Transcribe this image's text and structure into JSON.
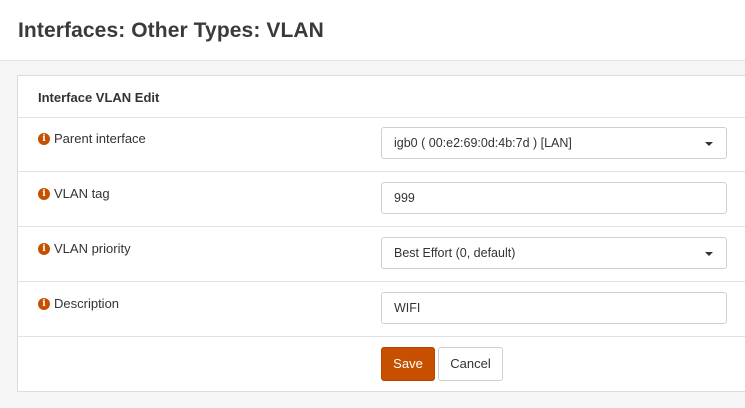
{
  "page": {
    "title": "Interfaces: Other Types: VLAN"
  },
  "panel": {
    "heading": "Interface VLAN Edit",
    "fields": [
      {
        "label": "Parent interface",
        "value": "igb0 ( 00:e2:69:0d:4b:7d ) [LAN]",
        "type": "select"
      },
      {
        "label": "VLAN tag",
        "value": "999",
        "type": "input"
      },
      {
        "label": "VLAN priority",
        "value": "Best Effort (0, default)",
        "type": "select"
      },
      {
        "label": "Description",
        "value": "WIFI",
        "type": "input"
      }
    ],
    "buttons": {
      "save_label": "Save",
      "cancel_label": "Cancel"
    }
  },
  "icons": {
    "info": "info-circle-icon",
    "dropdown": "caret-down-icon"
  },
  "colors": {
    "accent": "#c75000",
    "background": "#f5f5f5",
    "panel": "#ffffff"
  }
}
